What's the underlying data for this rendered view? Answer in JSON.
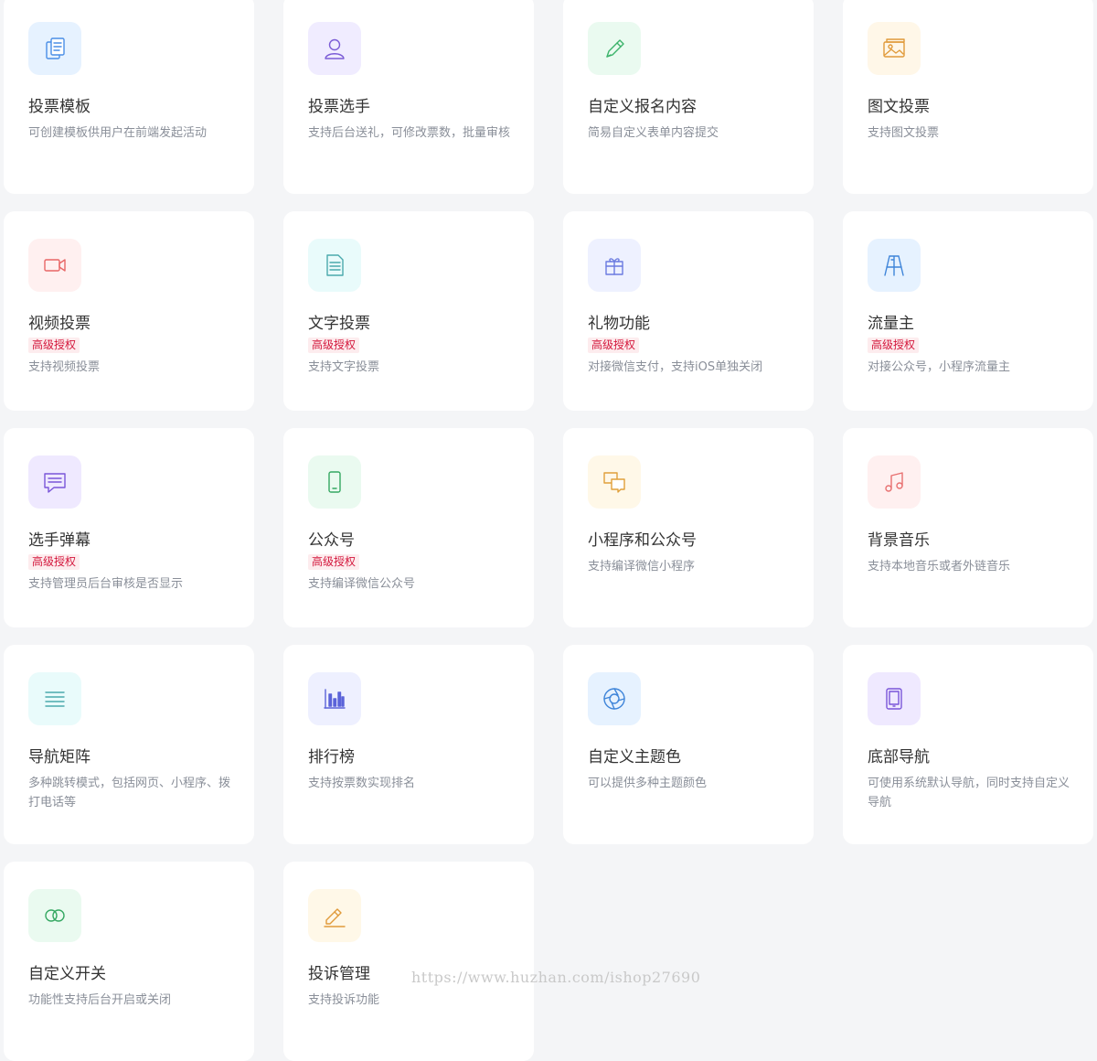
{
  "badge_label": "高级授权",
  "watermark": "https://www.huzhan.com/ishop27690",
  "cards": [
    {
      "title": "投票模板",
      "desc": "可创建模板供用户在前端发起活动",
      "icon": "document-copy-icon",
      "bg": "#e6f2ff",
      "color": "#4a8ee6"
    },
    {
      "title": "投票选手",
      "desc": "支持后台送礼，可修改票数，批量审核",
      "icon": "user-icon",
      "bg": "#f0ecff",
      "color": "#7b5cd6"
    },
    {
      "title": "自定义报名内容",
      "desc": "简易自定义表单内容提交",
      "icon": "pen-icon",
      "bg": "#eafaf0",
      "color": "#3bb36a"
    },
    {
      "title": "图文投票",
      "desc": "支持图文投票",
      "icon": "image-icon",
      "bg": "#fff7e8",
      "color": "#e09a3a"
    },
    {
      "title": "视频投票",
      "desc": "支持视频投票",
      "icon": "video-camera-icon",
      "bg": "#fff0f0",
      "color": "#e86666",
      "badge": true
    },
    {
      "title": "文字投票",
      "desc": "支持文字投票",
      "icon": "text-document-icon",
      "bg": "#e9fbfb",
      "color": "#4aa9ad",
      "badge": true
    },
    {
      "title": "礼物功能",
      "desc": "对接微信支付，支持iOS单独关闭",
      "icon": "gift-icon",
      "bg": "#eef1ff",
      "color": "#6b7be0",
      "badge": true
    },
    {
      "title": "流量主",
      "desc": "对接公众号，小程序流量主",
      "icon": "easel-icon",
      "bg": "#e6f2ff",
      "color": "#3f85d9",
      "badge": true
    },
    {
      "title": "选手弹幕",
      "desc": "支持管理员后台审核是否显示",
      "icon": "message-icon",
      "bg": "#efe9ff",
      "color": "#7a55d9",
      "badge": true
    },
    {
      "title": "公众号",
      "desc": "支持编译微信公众号",
      "icon": "phone-icon",
      "bg": "#eafaf0",
      "color": "#35a862",
      "badge": true
    },
    {
      "title": "小程序和公众号",
      "desc": "支持编译微信小程序",
      "icon": "chat-bubbles-icon",
      "bg": "#fff8e8",
      "color": "#e0a03a"
    },
    {
      "title": "背景音乐",
      "desc": "支持本地音乐或者外链音乐",
      "icon": "music-note-icon",
      "bg": "#fff0f0",
      "color": "#e87070"
    },
    {
      "title": "导航矩阵",
      "desc": "多种跳转模式，包括网页、小程序、拨打电话等",
      "icon": "list-icon",
      "bg": "#e9fbfb",
      "color": "#4aa9ad"
    },
    {
      "title": "排行榜",
      "desc": "支持按票数实现排名",
      "icon": "bar-chart-icon",
      "bg": "#eef0ff",
      "color": "#5b63d9"
    },
    {
      "title": "自定义主题色",
      "desc": "可以提供多种主题颜色",
      "icon": "aperture-icon",
      "bg": "#e6f2ff",
      "color": "#3f85d9"
    },
    {
      "title": "底部导航",
      "desc": "可使用系统默认导航，同时支持自定义导航",
      "icon": "tablet-icon",
      "bg": "#efe9ff",
      "color": "#7a55d9"
    },
    {
      "title": "自定义开关",
      "desc": "功能性支持后台开启或关闭",
      "icon": "toggle-icon",
      "bg": "#eafaf0",
      "color": "#35a862"
    },
    {
      "title": "投诉管理",
      "desc": "支持投诉功能",
      "icon": "edit-icon",
      "bg": "#fff8e8",
      "color": "#e09a3a"
    }
  ]
}
